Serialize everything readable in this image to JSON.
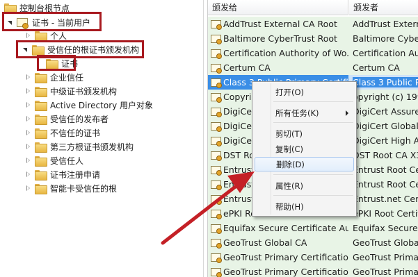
{
  "tree": {
    "items": [
      {
        "label": "控制台根节点"
      },
      {
        "label": "证书 - 当前用户"
      },
      {
        "label": "个人"
      },
      {
        "label": "受信任的根证书颁发机构"
      },
      {
        "label": "证书"
      },
      {
        "label": "企业信任"
      },
      {
        "label": "中级证书颁发机构"
      },
      {
        "label": "Active Directory 用户对象"
      },
      {
        "label": "受信任的发布者"
      },
      {
        "label": "不信任的证书"
      },
      {
        "label": "第三方根证书颁发机构"
      },
      {
        "label": "受信任人"
      },
      {
        "label": "证书注册申请"
      },
      {
        "label": "智能卡受信任的根"
      }
    ]
  },
  "list": {
    "headers": {
      "issued_to": "颁发给",
      "issued_by": "颁发者"
    },
    "rows": [
      {
        "to": "AddTrust External CA Root",
        "by": "AddTrust External"
      },
      {
        "to": "Baltimore CyberTrust Root",
        "by": "Baltimore Cyber"
      },
      {
        "to": "Certification Authority of Wo...",
        "by": "Certification Auth"
      },
      {
        "to": "Certum CA",
        "by": "Certum CA"
      },
      {
        "to": "Class 3 Public Primary Certifi...",
        "by": "Class 3 Public Pr"
      },
      {
        "to": "Copyri",
        "by": "opyright (c) 199"
      },
      {
        "to": "DigiCe",
        "by": "DigiCert Assured"
      },
      {
        "to": "DigiCe",
        "by": "DigiCert Global R"
      },
      {
        "to": "DigiCe",
        "by": "DigiCert High As"
      },
      {
        "to": "DST Ro",
        "by": "DST Root CA X3"
      },
      {
        "to": "Entrust",
        "by": "Entrust Root Cert"
      },
      {
        "to": "Entrust",
        "by": "Entrust Root Cert"
      },
      {
        "to": "Entrust",
        "by": "Entrust.net Certif"
      },
      {
        "to": "ePKI Root Certification Auth",
        "by": "ePKI Root Certific"
      },
      {
        "to": "Equifax Secure Certificate Au...",
        "by": "Equifax Secure Ce"
      },
      {
        "to": "GeoTrust Global CA",
        "by": "GeoTrust Global"
      },
      {
        "to": "GeoTrust Primary Certification...",
        "by": "GeoTrust Primary"
      },
      {
        "to": "GeoTrust Primary Certification...",
        "by": "GeoTrust Primary"
      }
    ]
  },
  "menu": {
    "open": "打开(O)",
    "all_tasks": "所有任务(K)",
    "cut": "剪切(T)",
    "copy": "复制(C)",
    "delete": "删除(D)",
    "properties": "属性(R)",
    "help": "帮助(H)"
  },
  "colors": {
    "highlight_box": "#a8191f",
    "arrow": "#c42026",
    "row_bg": "#e8f4e6",
    "selected": "#3a8ee6"
  }
}
